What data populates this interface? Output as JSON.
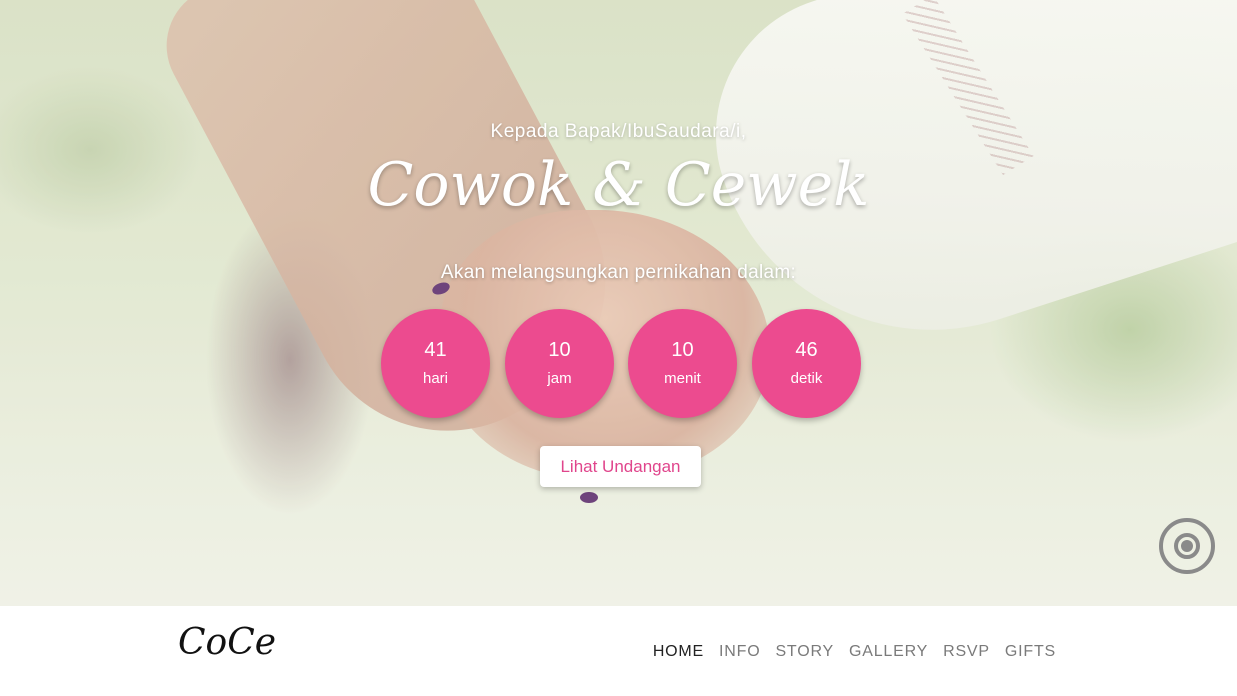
{
  "hero": {
    "greeting": "Kepada Bapak/IbuSaudara/i,",
    "names": "Cowok & Cewek",
    "subtitle": "Akan melangsungkan pernikahan dalam:",
    "countdown": [
      {
        "value": "41",
        "unit": "hari"
      },
      {
        "value": "10",
        "unit": "jam"
      },
      {
        "value": "10",
        "unit": "menit"
      },
      {
        "value": "46",
        "unit": "detik"
      }
    ],
    "cta_label": "Lihat Undangan",
    "music_icon": "broadcast-icon"
  },
  "navbar": {
    "brand": "CoCe",
    "items": [
      {
        "label": "HOME",
        "active": true
      },
      {
        "label": "INFO",
        "active": false
      },
      {
        "label": "STORY",
        "active": false
      },
      {
        "label": "GALLERY",
        "active": false
      },
      {
        "label": "RSVP",
        "active": false
      },
      {
        "label": "GIFTS",
        "active": false
      }
    ]
  },
  "colors": {
    "accent": "#ec4b8f",
    "cta_text": "#e0458c",
    "nav_active": "#222222",
    "nav_inactive": "#7a7a7a"
  }
}
